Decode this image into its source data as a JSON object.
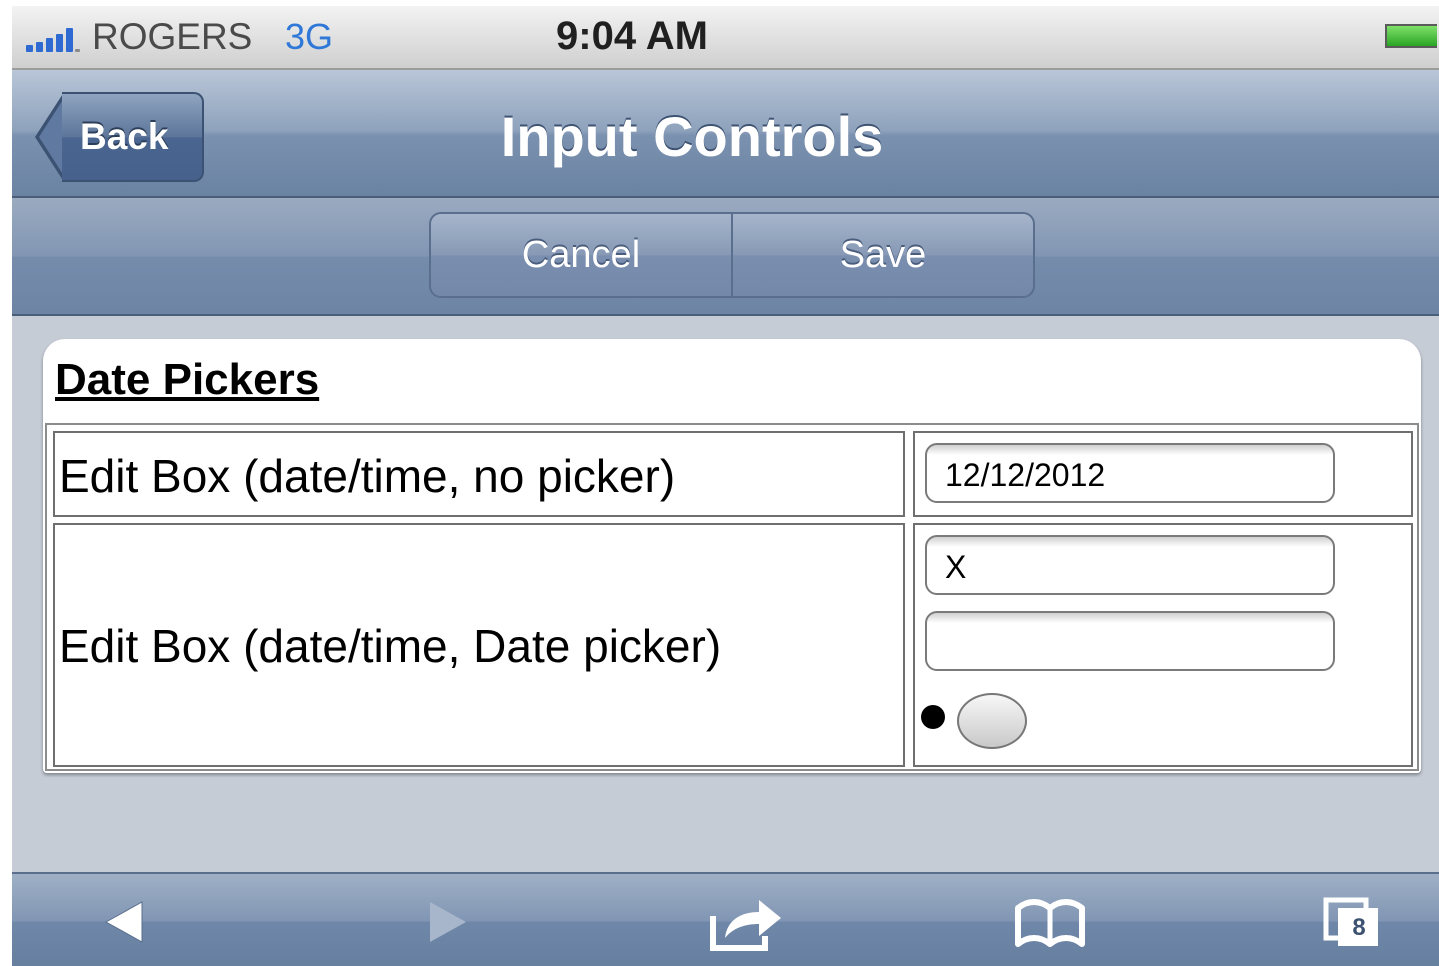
{
  "status_bar": {
    "carrier": "ROGERS",
    "network": "3G",
    "time": "9:04 AM"
  },
  "title_bar": {
    "back_label": "Back",
    "title": "Input Controls"
  },
  "toolbar": {
    "cancel_label": "Cancel",
    "save_label": "Save"
  },
  "section": {
    "title": "Date Pickers",
    "rows": [
      {
        "label": "Edit Box (date/time, no picker)",
        "inputs": [
          "12/12/2012"
        ]
      },
      {
        "label": "Edit Box (date/time, Date picker)",
        "inputs": [
          "X",
          ""
        ]
      }
    ]
  },
  "browser_bar": {
    "tab_count": "8"
  },
  "colors": {
    "accent_blue": "#2f78d8",
    "nav_bar": "#7a91af",
    "background": "#c5ccd6"
  },
  "icons": [
    "signal-icon",
    "battery-icon",
    "back-arrow-icon",
    "forward-arrow-icon",
    "share-icon",
    "bookmarks-icon",
    "tabs-icon"
  ]
}
